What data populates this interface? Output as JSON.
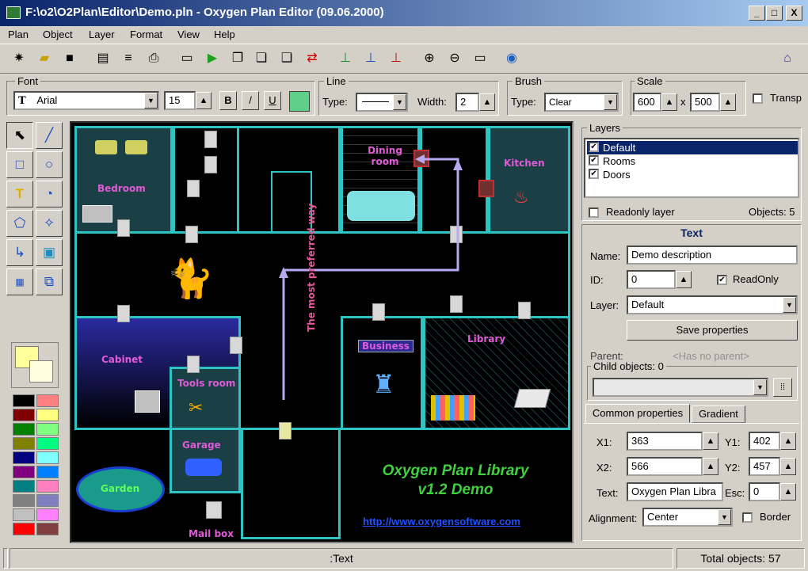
{
  "window": {
    "title": "F:\\o2\\O2Plan\\Editor\\Demo.pln - Oxygen Plan Editor (09.06.2000)",
    "minimize": "_",
    "maximize": "□",
    "close": "X"
  },
  "menu": [
    "Plan",
    "Object",
    "Layer",
    "Format",
    "View",
    "Help"
  ],
  "format": {
    "font_label": "Font",
    "font_value": "Arial",
    "size_value": "15",
    "bold": "B",
    "italic": "/",
    "underline": "U",
    "line_label": "Line",
    "line_type_label": "Type:",
    "line_width_label": "Width:",
    "line_width_value": "2",
    "brush_label": "Brush",
    "brush_type_label": "Type:",
    "brush_type_value": "Clear",
    "scale_label": "Scale",
    "scale_x": "600",
    "scale_sep": "x",
    "scale_y": "500",
    "transp_label": "Transp",
    "font_color": "#5fcf8a"
  },
  "canvas": {
    "rooms": {
      "bedroom": "Bedroom",
      "dining": "Dining room",
      "kitchen": "Kitchen",
      "cabinet": "Cabinet",
      "tools": "Tools room",
      "business": "Business",
      "library": "Library",
      "garage": "Garage",
      "garden": "Garden",
      "mailbox": "Mail box"
    },
    "way_label": "The most preferred way",
    "library_title_1": "Oxygen Plan Library",
    "library_title_2": "v1.2 Demo",
    "url": "http://www.oxygensoftware.com"
  },
  "layers": {
    "title": "Layers",
    "items": [
      {
        "label": "Default",
        "checked": true
      },
      {
        "label": "Rooms",
        "checked": true
      },
      {
        "label": "Doors",
        "checked": true
      }
    ],
    "readonly_label": "Readonly layer",
    "objects_label": "Objects: 5"
  },
  "props": {
    "header": "Text",
    "name_label": "Name:",
    "name_value": "Demo description",
    "id_label": "ID:",
    "id_value": "0",
    "readonly_label": "ReadOnly",
    "layer_label": "Layer:",
    "layer_value": "Default",
    "save_button": "Save properties",
    "parent_label": "Parent:",
    "parent_value": "<Has no parent>",
    "child_label": "Child objects: 0",
    "tab_common": "Common properties",
    "tab_gradient": "Gradient",
    "x1_label": "X1:",
    "x1_value": "363",
    "y1_label": "Y1:",
    "y1_value": "402",
    "x2_label": "X2:",
    "x2_value": "566",
    "y2_label": "Y2:",
    "y2_value": "457",
    "text_label": "Text:",
    "text_value": "Oxygen Plan Libra",
    "esc_label": "Esc:",
    "esc_value": "0",
    "align_label": "Alignment:",
    "align_value": "Center",
    "border_label": "Border"
  },
  "palette": [
    "#000000",
    "#ff8080",
    "#800000",
    "#ffff80",
    "#008000",
    "#80ff80",
    "#808000",
    "#00ff80",
    "#000080",
    "#80ffff",
    "#800080",
    "#0080ff",
    "#008080",
    "#ff80c0",
    "#808080",
    "#8080c0",
    "#c0c0c0",
    "#ff80ff",
    "#ff0000",
    "#804040"
  ],
  "status": {
    "left": "",
    "mid": ":Text",
    "right": "Total objects: 57"
  }
}
